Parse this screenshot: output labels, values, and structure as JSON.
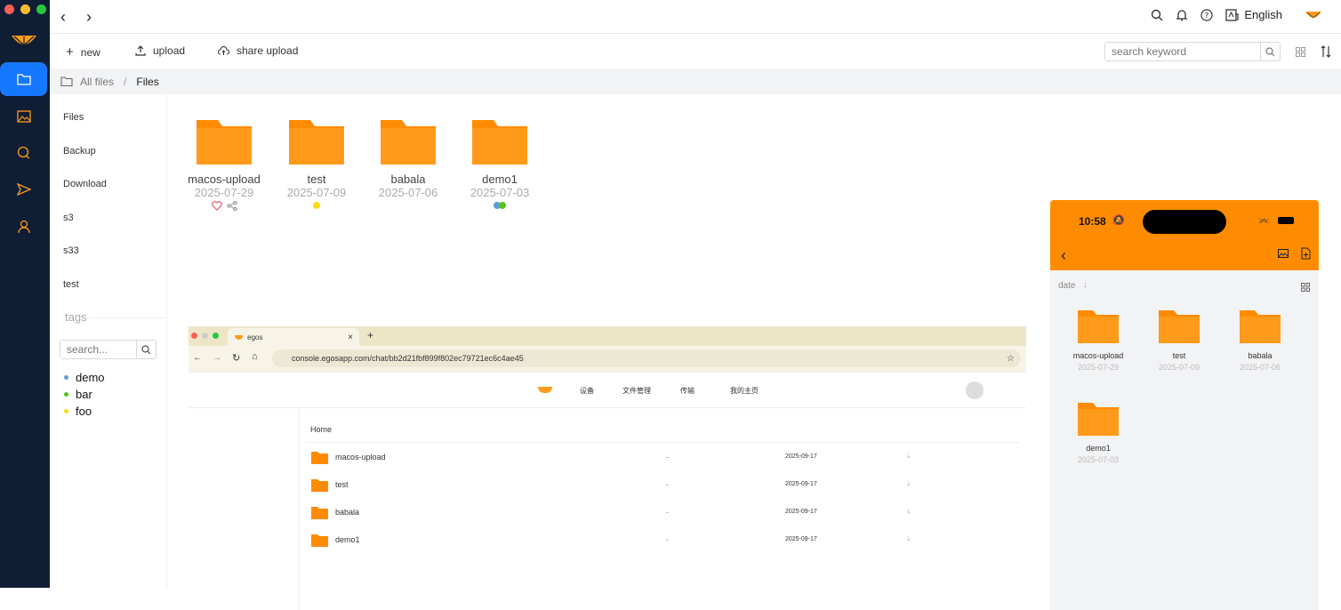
{
  "window": {
    "language_label": "English"
  },
  "toolbar": {
    "new_label": "new",
    "upload_label": "upload",
    "share_upload_label": "share upload",
    "search_placeholder": "search keyword"
  },
  "breadcrumb": {
    "root": "All files",
    "separator": "/",
    "current": "Files"
  },
  "sidebar": {
    "items": [
      "Files",
      "Backup",
      "Download",
      "s3",
      "s33",
      "test"
    ],
    "tags_heading": "tags",
    "tag_search_placeholder": "search...",
    "tags": [
      {
        "name": "demo",
        "color": "#5b9bd5"
      },
      {
        "name": "bar",
        "color": "#52c41a"
      },
      {
        "name": "foo",
        "color": "#fadb14"
      }
    ]
  },
  "folders": [
    {
      "name": "macos-upload",
      "date": "2025-07-29"
    },
    {
      "name": "test",
      "date": "2025-07-09"
    },
    {
      "name": "babala",
      "date": "2025-07-06"
    },
    {
      "name": "demo1",
      "date": "2025-07-03"
    }
  ],
  "colors": {
    "accent": "#ff8c00",
    "rail": "#0f1e34",
    "active": "#1677ff"
  },
  "browser_shot": {
    "tab_title": "egos",
    "url": "console.egosapp.com/chat/bb2d21fbf899f802ec79721ec6c4ae45",
    "nav": [
      "设备",
      "文件管理",
      "传输",
      "我的主页"
    ],
    "crumb": "Home",
    "rows": [
      {
        "name": "macos-upload",
        "size": "-",
        "date": "2025-09-17"
      },
      {
        "name": "test",
        "size": "-",
        "date": "2025-09-17"
      },
      {
        "name": "babala",
        "size": "-",
        "date": "2025-09-17"
      },
      {
        "name": "demo1",
        "size": "-",
        "date": "2025-09-17"
      }
    ]
  },
  "phone": {
    "time": "10:58",
    "sort_label": "date",
    "folders": [
      {
        "name": "macos-upload",
        "date": "2025-07-29"
      },
      {
        "name": "test",
        "date": "2025-07-09"
      },
      {
        "name": "babala",
        "date": "2025-07-06"
      },
      {
        "name": "demo1",
        "date": "2025-07-03"
      }
    ]
  }
}
